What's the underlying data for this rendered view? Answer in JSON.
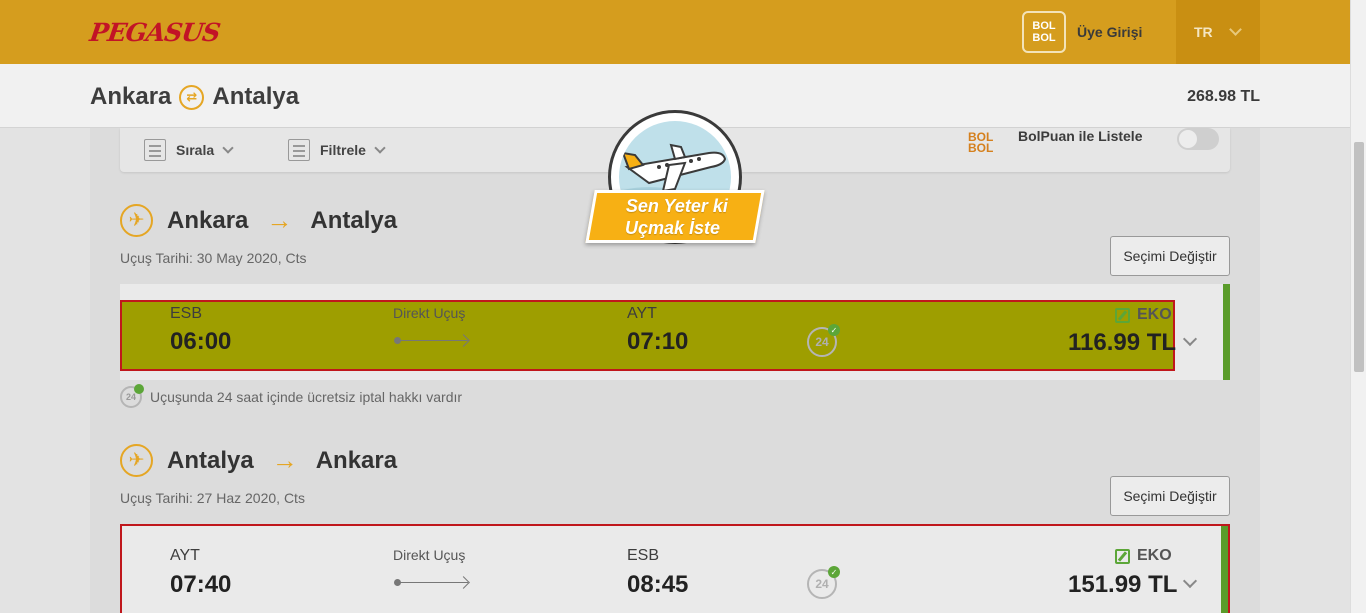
{
  "header": {
    "logo": "PEGASUS",
    "bolbol_top": "BOL",
    "bolbol_bottom": "BOL",
    "login": "Üye Girişi",
    "language": "TR"
  },
  "subheader": {
    "origin": "Ankara",
    "destination": "Antalya",
    "total_price": "268.98 TL"
  },
  "filters": {
    "sort_label": "Sırala",
    "filter_label": "Filtrele",
    "bolpuan_logo_top": "BOL",
    "bolpuan_logo_bottom": "BOL",
    "bolpuan_label": "BolPuan ile Listele",
    "bolpuan_enabled": false
  },
  "promo": {
    "line1": "Sen Yeter ki",
    "line2": "Uçmak İste"
  },
  "legs": [
    {
      "from": "Ankara",
      "to": "Antalya",
      "date": "Uçuş Tarihi: 30 May 2020, Cts",
      "change_button": "Seçimi Değiştir",
      "flight": {
        "dep_code": "ESB",
        "dep_time": "06:00",
        "type": "Direkt Uçuş",
        "arr_code": "AYT",
        "arr_time": "07:10",
        "cancel_badge": "24",
        "fare_class": "EKO",
        "price": "116.99 TL"
      },
      "notice": "Uçuşunda 24 saat içinde ücretsiz iptal hakkı vardır"
    },
    {
      "from": "Antalya",
      "to": "Ankara",
      "date": "Uçuş Tarihi: 27 Haz 2020, Cts",
      "change_button": "Seçimi Değiştir",
      "flight": {
        "dep_code": "AYT",
        "dep_time": "07:40",
        "type": "Direkt Uçuş",
        "arr_code": "ESB",
        "arr_time": "08:45",
        "cancel_badge": "24",
        "fare_class": "EKO",
        "price": "151.99 TL"
      }
    }
  ],
  "colors": {
    "brand_yellow": "#d59d1e",
    "accent_orange": "#e5a624",
    "highlight": "#9e9e00",
    "select_border": "#c0171c",
    "selected_bar": "#5a9c2a"
  }
}
